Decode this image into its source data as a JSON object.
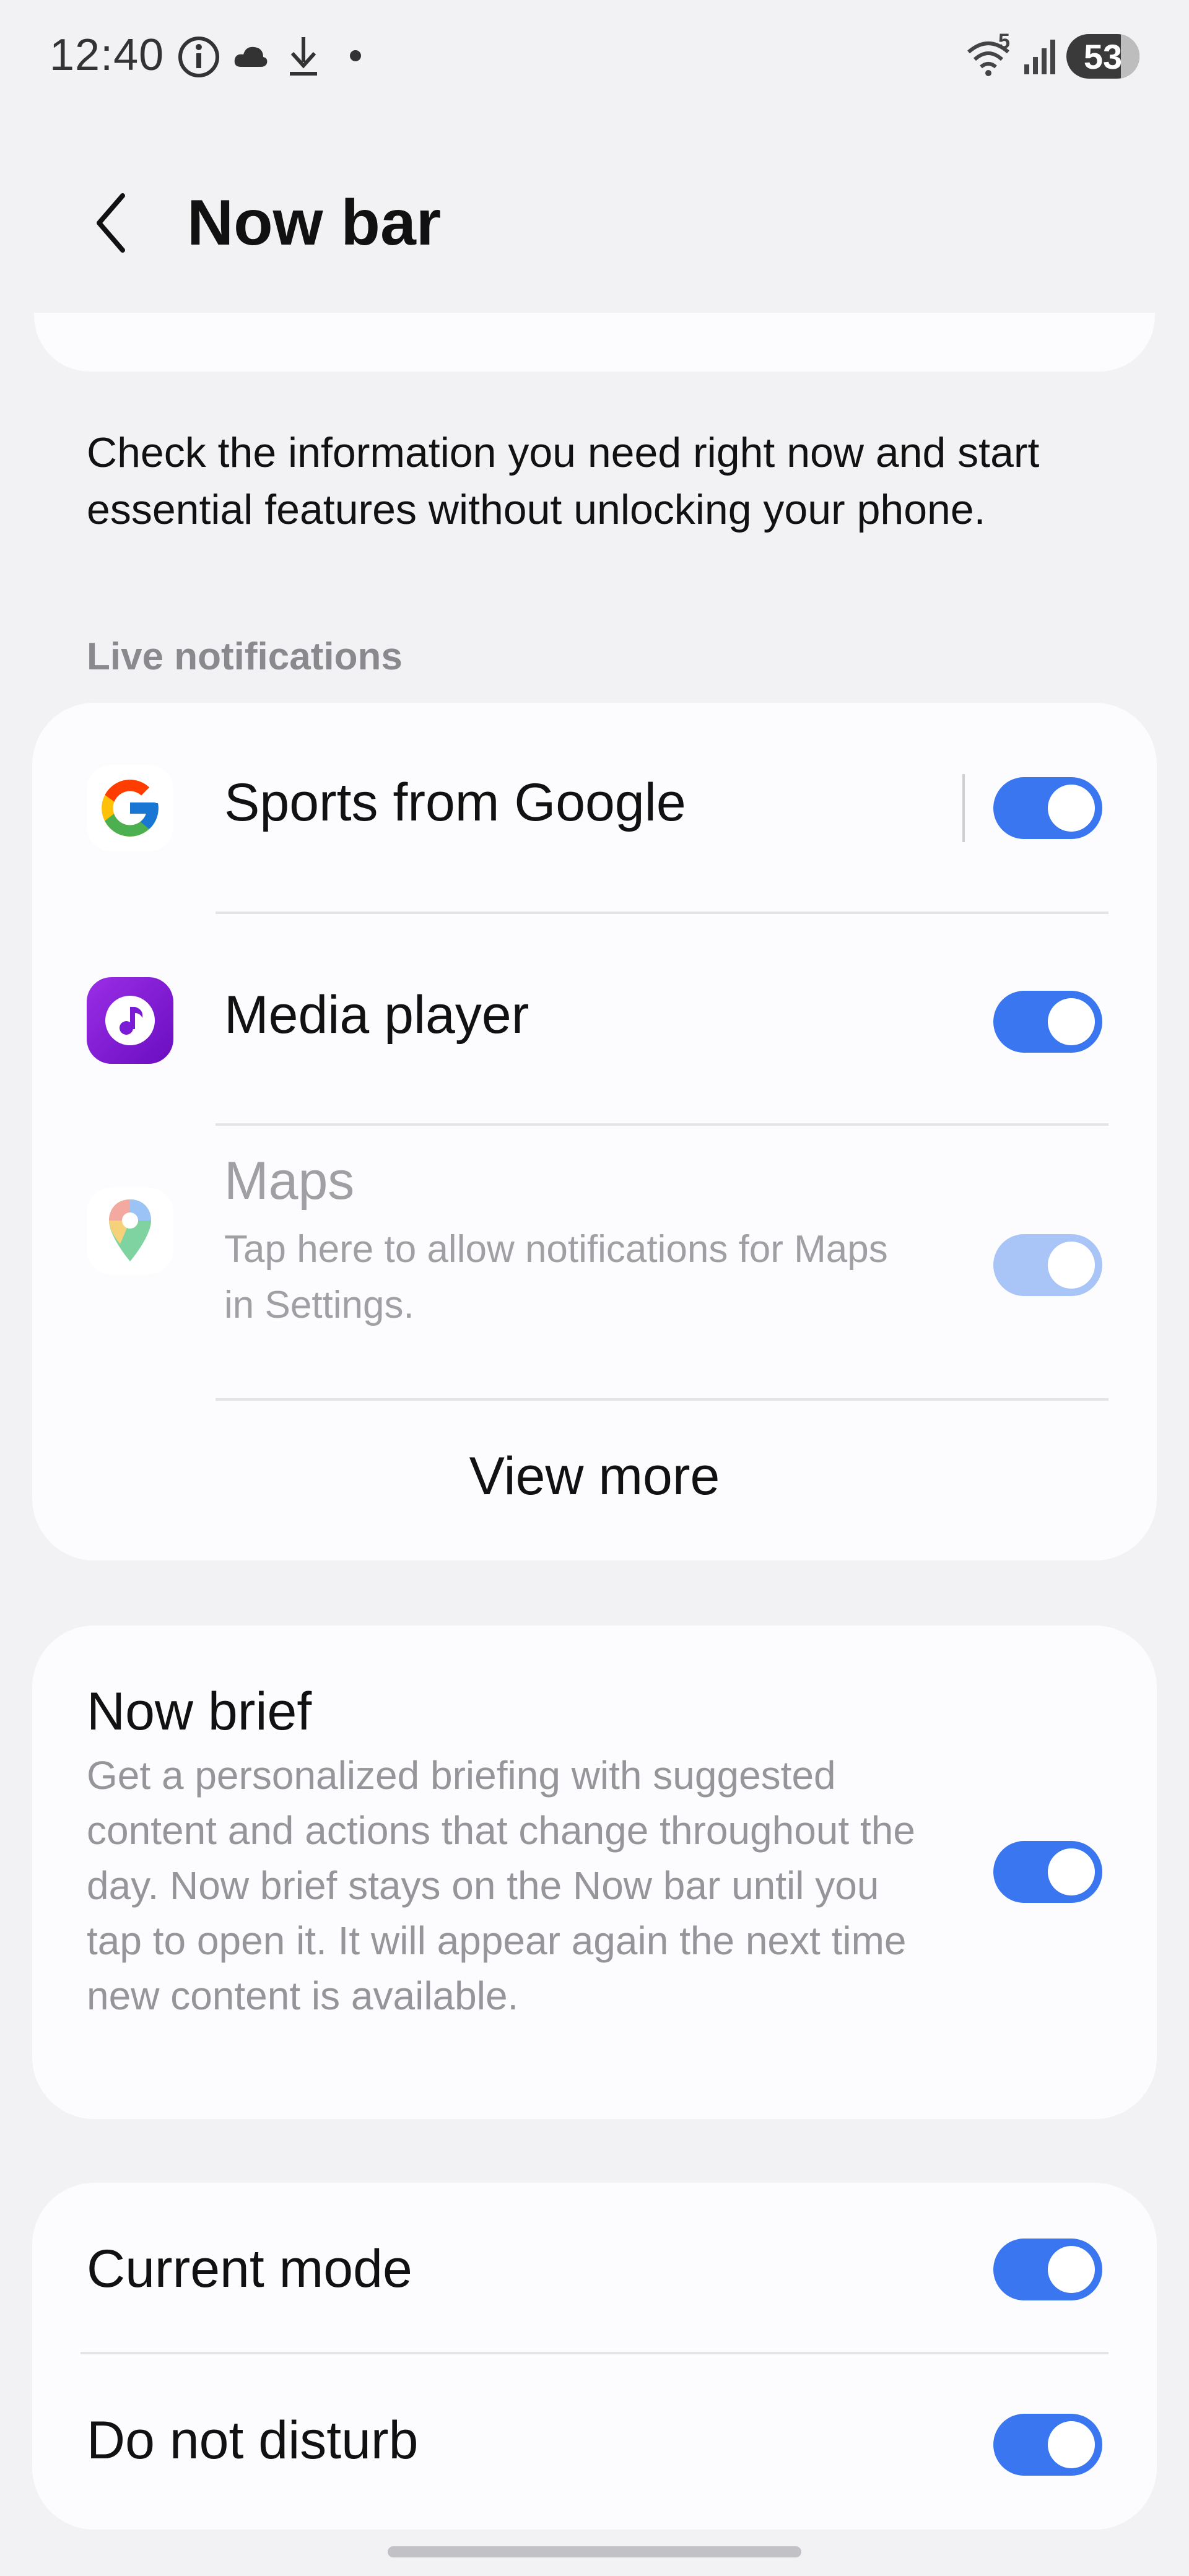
{
  "status_bar": {
    "time": "12:40",
    "battery": "53",
    "network_badge": "5",
    "left_icons": [
      "info-icon",
      "cloud-icon",
      "download-icon",
      "dot-icon"
    ],
    "right_icons": [
      "wifi-icon",
      "signal-icon",
      "battery-icon"
    ]
  },
  "header": {
    "title": "Now bar",
    "back_icon": "chevron-left-icon"
  },
  "intro": {
    "text": "Check the information you need right now and start essential features without unlocking your phone."
  },
  "live_notifications": {
    "section_label": "Live notifications",
    "items": [
      {
        "title": "Sports from Google",
        "icon": "google-icon",
        "enabled": true,
        "dimmed": false
      },
      {
        "title": "Media player",
        "icon": "media-player-icon",
        "enabled": true,
        "dimmed": false
      },
      {
        "title": "Maps",
        "subtitle": "Tap here to allow notifications for Maps in Settings.",
        "icon": "maps-icon",
        "enabled": true,
        "dimmed": true
      }
    ],
    "view_more": "View more"
  },
  "now_brief": {
    "title": "Now brief",
    "description": "Get a personalized briefing with suggested content and actions that change throughout the day. Now brief stays on the Now bar until you tap to open it. It will appear again the next time new content is available.",
    "enabled": true
  },
  "modes": {
    "items": [
      {
        "title": "Current mode",
        "enabled": true
      },
      {
        "title": "Do not disturb",
        "enabled": true
      }
    ]
  },
  "colors": {
    "accent": "#3a76f0",
    "accent_disabled": "#a9c4f6",
    "background": "#f2f2f4",
    "card": "#fcfcfe",
    "secondary_text": "#8a8a8e"
  }
}
